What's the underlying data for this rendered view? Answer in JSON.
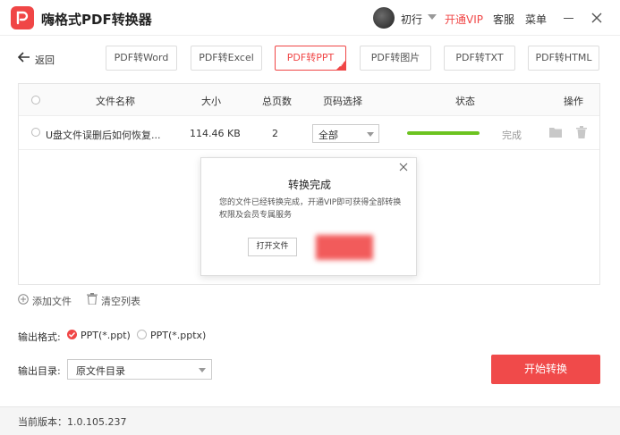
{
  "app": {
    "title": "嗨格式PDF转换器"
  },
  "user": {
    "name": "初行"
  },
  "header": {
    "vip_label": "开通VIP",
    "service_label": "客服",
    "menu_label": "菜单"
  },
  "nav": {
    "back_label": "返回"
  },
  "tabs": [
    {
      "label": "PDF转Word"
    },
    {
      "label": "PDF转Excel"
    },
    {
      "label": "PDF转PPT",
      "active": true
    },
    {
      "label": "PDF转图片"
    },
    {
      "label": "PDF转TXT"
    },
    {
      "label": "PDF转HTML"
    }
  ],
  "table": {
    "columns": [
      "文件名称",
      "大小",
      "总页数",
      "页码选择",
      "状态",
      "操作"
    ],
    "rows": [
      {
        "name": "U盘文件误删后如何恢复...",
        "size": "114.46 KB",
        "pages": "2",
        "page_select": "全部",
        "progress": 1.0,
        "status": "完成"
      }
    ]
  },
  "dialog": {
    "title": "转换完成",
    "message": "您的文件已经转换完成，开通VIP即可获得全部转换权限及会员专属服务",
    "open_file_label": "打开文件"
  },
  "actions": {
    "add_file_label": "添加文件",
    "clear_list_label": "清空列表"
  },
  "output": {
    "format_label": "输出格式:",
    "formats": [
      {
        "label": "PPT(*.ppt)",
        "selected": true
      },
      {
        "label": "PPT(*.pptx)",
        "selected": false
      }
    ],
    "dir_label": "输出目录:",
    "dir_value": "原文件目录"
  },
  "start_label": "开始转换",
  "footer": {
    "version": "当前版本：1.0.105.237"
  },
  "colors": {
    "accent": "#f04646",
    "progress": "#6cc320"
  }
}
